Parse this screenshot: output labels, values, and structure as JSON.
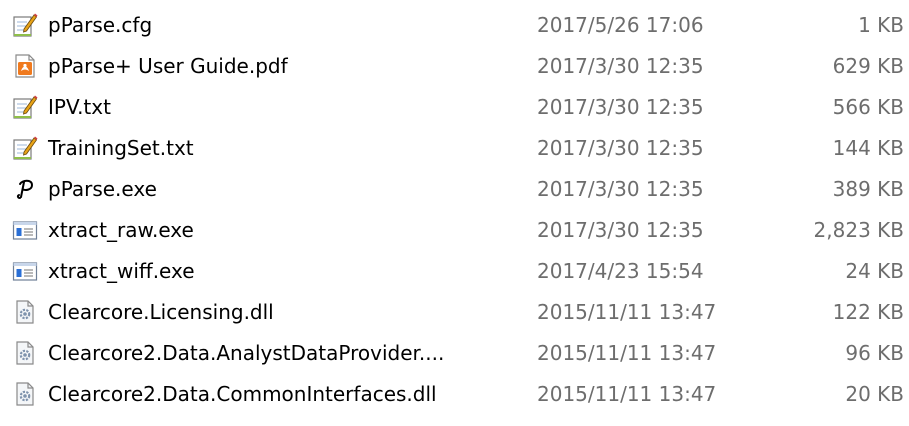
{
  "files": [
    {
      "name": "pParse.cfg",
      "date": "2017/5/26 17:06",
      "size": "1 KB",
      "icon": "notepad-icon"
    },
    {
      "name": "pParse+ User Guide.pdf",
      "date": "2017/3/30 12:35",
      "size": "629 KB",
      "icon": "pdf-icon"
    },
    {
      "name": "IPV.txt",
      "date": "2017/3/30 12:35",
      "size": "566 KB",
      "icon": "notepad-icon"
    },
    {
      "name": "TrainingSet.txt",
      "date": "2017/3/30 12:35",
      "size": "144 KB",
      "icon": "notepad-icon"
    },
    {
      "name": "pParse.exe",
      "date": "2017/3/30 12:35",
      "size": "389 KB",
      "icon": "pparse-app-icon"
    },
    {
      "name": "xtract_raw.exe",
      "date": "2017/3/30 12:35",
      "size": "2,823 KB",
      "icon": "exe-window-icon"
    },
    {
      "name": "xtract_wiff.exe",
      "date": "2017/4/23 15:54",
      "size": "24 KB",
      "icon": "exe-window-icon"
    },
    {
      "name": "Clearcore.Licensing.dll",
      "date": "2015/11/11 13:47",
      "size": "122 KB",
      "icon": "dll-gear-icon"
    },
    {
      "name": "Clearcore2.Data.AnalystDataProvider....",
      "date": "2015/11/11 13:47",
      "size": "96 KB",
      "icon": "dll-gear-icon"
    },
    {
      "name": "Clearcore2.Data.CommonInterfaces.dll",
      "date": "2015/11/11 13:47",
      "size": "20 KB",
      "icon": "dll-gear-icon"
    }
  ],
  "colors": {
    "secondary_text": "#6d6d6d",
    "pdf_accent": "#f07a1e",
    "exe_accent": "#2a6fd6",
    "notepad_pen": "#e8a317"
  }
}
